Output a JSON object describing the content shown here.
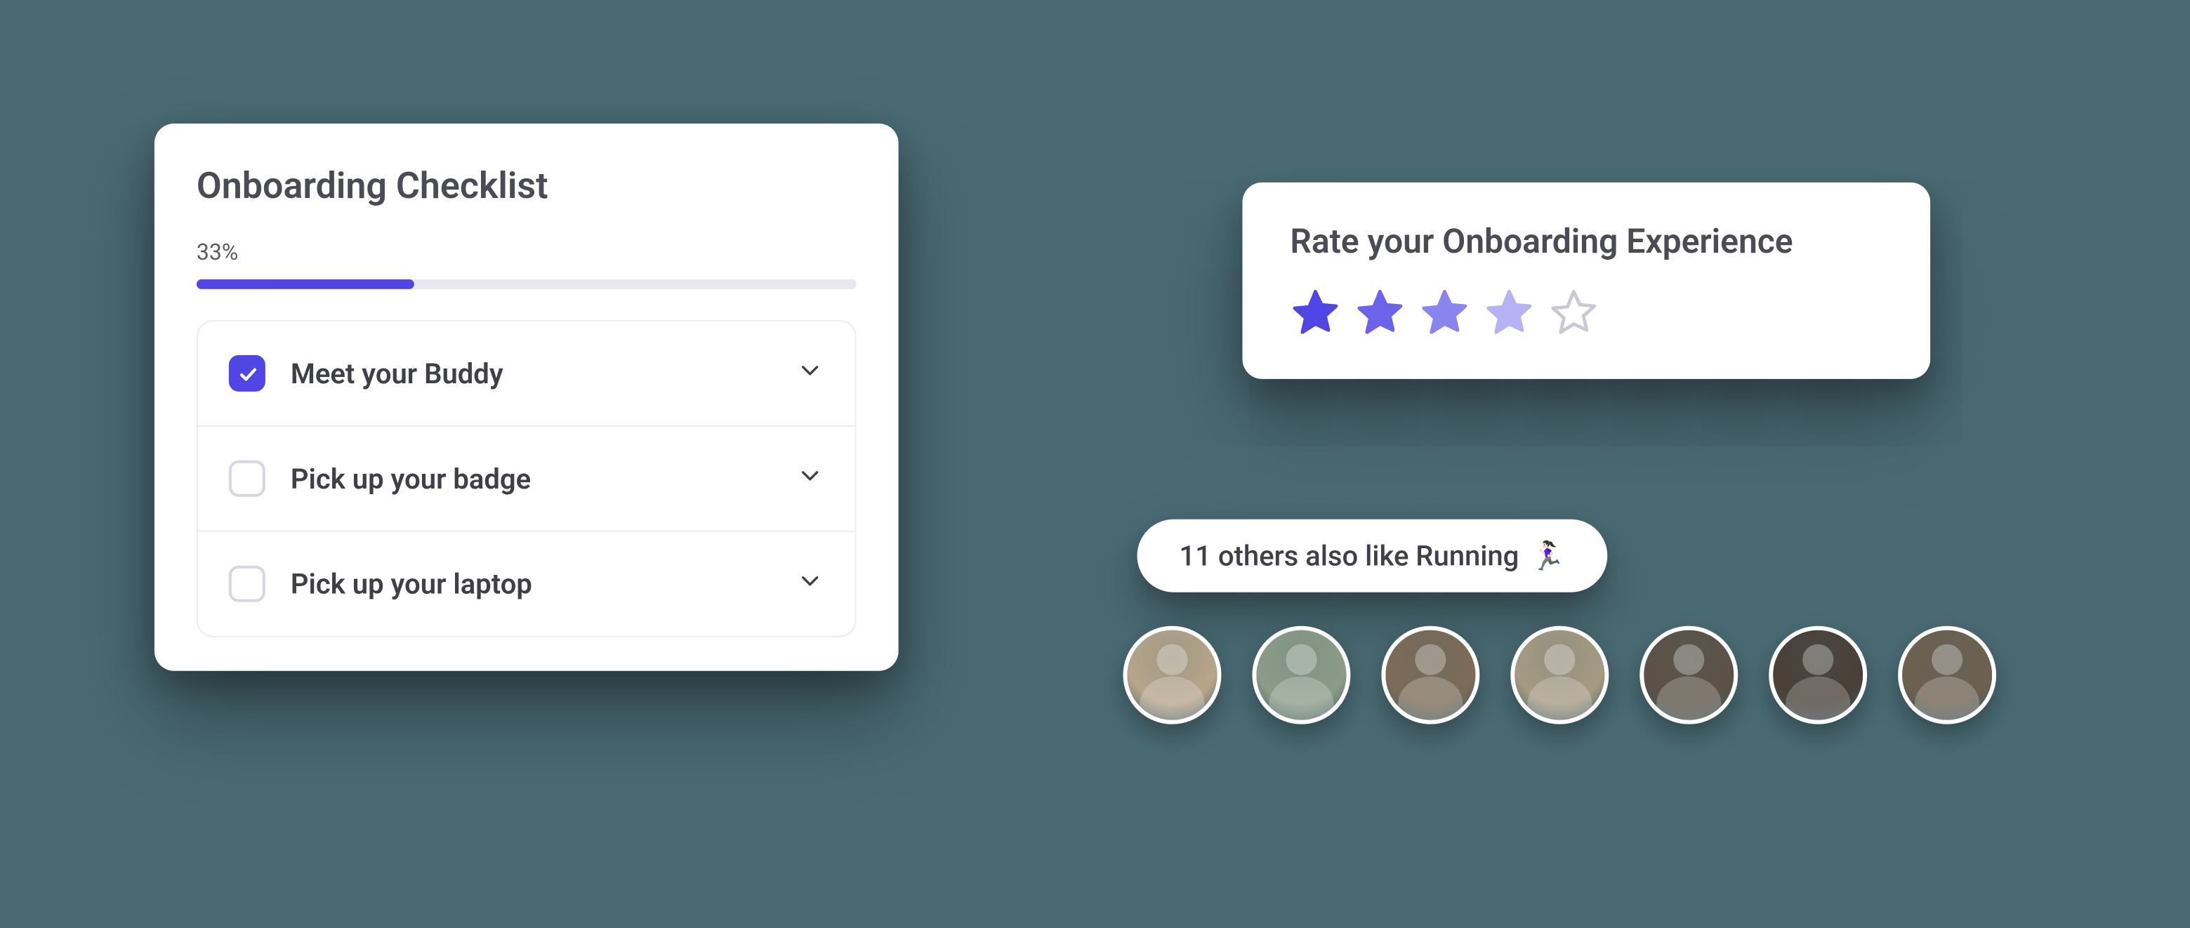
{
  "checklist": {
    "title": "Onboarding Checklist",
    "progress_label": "33%",
    "progress_pct": 33,
    "items": [
      {
        "label": "Meet your Buddy",
        "done": true
      },
      {
        "label": "Pick up your badge",
        "done": false
      },
      {
        "label": "Pick up your laptop",
        "done": false
      }
    ]
  },
  "rating": {
    "title": "Rate your Onboarding Experience",
    "stars": [
      {
        "fill": "#4f46e5",
        "opacity": 1.0,
        "stroke": "#4f46e5"
      },
      {
        "fill": "#6b63ea",
        "opacity": 1.0,
        "stroke": "#6b63ea"
      },
      {
        "fill": "#8a84ef",
        "opacity": 1.0,
        "stroke": "#8a84ef"
      },
      {
        "fill": "#b6b2f5",
        "opacity": 1.0,
        "stroke": "#b6b2f5"
      },
      {
        "fill": "none",
        "opacity": 1.0,
        "stroke": "#c9c9d4"
      }
    ]
  },
  "social": {
    "text": "11 others also like Running",
    "emoji": "🏃🏻‍♀️",
    "avatar_colors": [
      "#b7a58a",
      "#8d9c88",
      "#7d6b57",
      "#a79a83",
      "#5d5145",
      "#4a3f36",
      "#6e604f"
    ]
  }
}
